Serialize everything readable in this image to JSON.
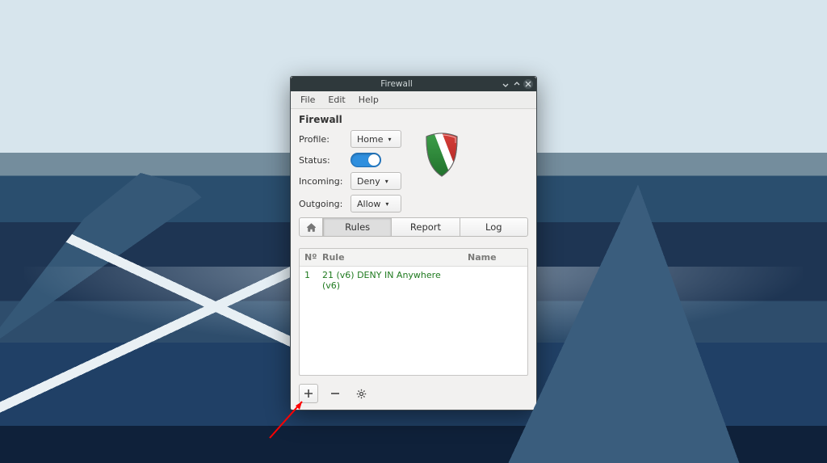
{
  "window": {
    "title": "Firewall"
  },
  "menubar": [
    "File",
    "Edit",
    "Help"
  ],
  "panel": {
    "heading": "Firewall",
    "labels": {
      "profile": "Profile:",
      "status": "Status:",
      "incoming": "Incoming:",
      "outgoing": "Outgoing:"
    },
    "values": {
      "profile": "Home",
      "incoming": "Deny",
      "outgoing": "Allow",
      "status_on": true
    }
  },
  "tabs": {
    "rules": "Rules",
    "report": "Report",
    "log": "Log"
  },
  "list": {
    "columns": {
      "n": "Nº",
      "rule": "Rule",
      "name": "Name"
    },
    "rows": [
      {
        "n": "1",
        "rule": "21 (v6) DENY IN Anywhere (v6)",
        "name": ""
      }
    ]
  },
  "icons": {
    "home": "⌂",
    "add": "＋",
    "remove": "−",
    "gear": "⚙"
  }
}
